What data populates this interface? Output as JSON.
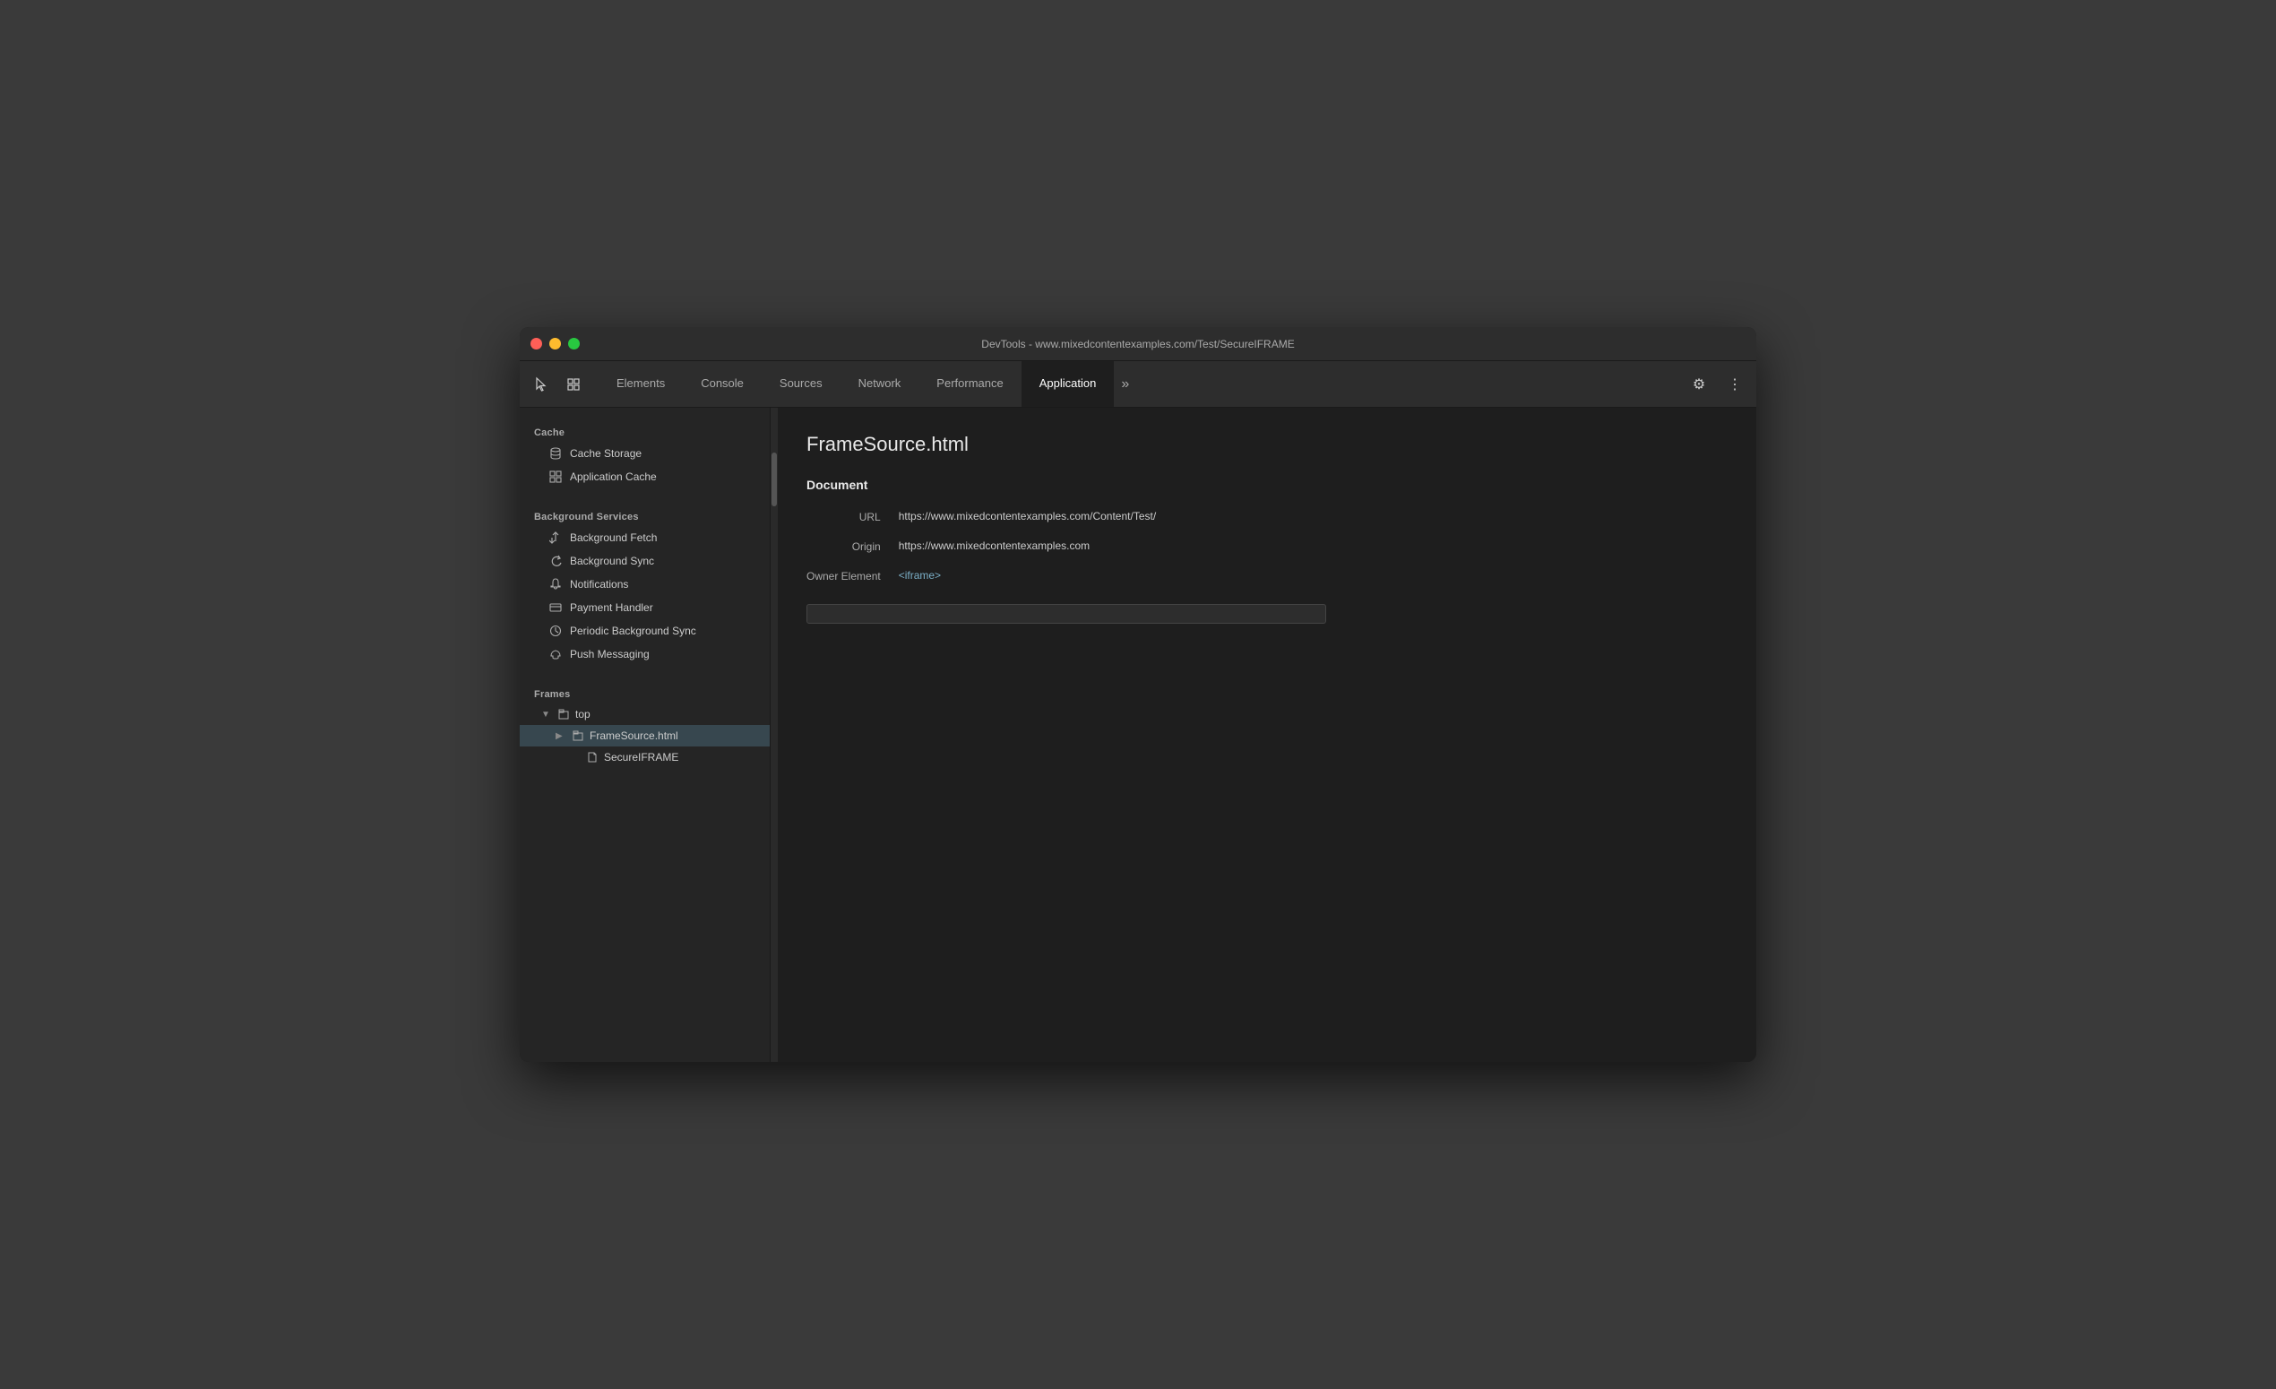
{
  "window": {
    "title": "DevTools - www.mixedcontentexamples.com/Test/SecureIFRAME"
  },
  "toolbar": {
    "tabs": [
      {
        "id": "elements",
        "label": "Elements",
        "active": false
      },
      {
        "id": "console",
        "label": "Console",
        "active": false
      },
      {
        "id": "sources",
        "label": "Sources",
        "active": false
      },
      {
        "id": "network",
        "label": "Network",
        "active": false
      },
      {
        "id": "performance",
        "label": "Performance",
        "active": false
      },
      {
        "id": "application",
        "label": "Application",
        "active": true
      }
    ],
    "more_label": "»",
    "settings_icon": "⚙",
    "menu_icon": "⋮"
  },
  "sidebar": {
    "sections": {
      "cache": {
        "label": "Cache",
        "items": [
          {
            "id": "cache-storage",
            "label": "Cache Storage",
            "icon": "db"
          },
          {
            "id": "application-cache",
            "label": "Application Cache",
            "icon": "grid"
          }
        ]
      },
      "background_services": {
        "label": "Background Services",
        "items": [
          {
            "id": "background-fetch",
            "label": "Background Fetch",
            "icon": "updown"
          },
          {
            "id": "background-sync",
            "label": "Background Sync",
            "icon": "sync"
          },
          {
            "id": "notifications",
            "label": "Notifications",
            "icon": "bell"
          },
          {
            "id": "payment-handler",
            "label": "Payment Handler",
            "icon": "card"
          },
          {
            "id": "periodic-background-sync",
            "label": "Periodic Background Sync",
            "icon": "clock"
          },
          {
            "id": "push-messaging",
            "label": "Push Messaging",
            "icon": "cloud"
          }
        ]
      },
      "frames": {
        "label": "Frames"
      }
    },
    "frames_tree": [
      {
        "id": "top",
        "label": "top",
        "level": 1,
        "arrow": "▼",
        "icon": "□",
        "selected": false
      },
      {
        "id": "framesource",
        "label": "FrameSource.html",
        "level": 2,
        "arrow": "▶",
        "icon": "□",
        "selected": true
      },
      {
        "id": "secureiframe",
        "label": "SecureIFRAME",
        "level": 3,
        "arrow": "",
        "icon": "doc",
        "selected": false
      }
    ]
  },
  "content": {
    "title": "FrameSource.html",
    "section_heading": "Document",
    "fields": [
      {
        "id": "url",
        "label": "URL",
        "value": "https://www.mixedcontentexamples.com/Content/Test/",
        "is_link": false
      },
      {
        "id": "origin",
        "label": "Origin",
        "value": "https://www.mixedcontentexamples.com",
        "is_link": false
      },
      {
        "id": "owner-element",
        "label": "Owner Element",
        "value": "<iframe>",
        "is_link": true
      }
    ]
  },
  "icons": {
    "cursor": "↖",
    "layers": "⧉",
    "db": "🗄",
    "grid": "▦",
    "updown": "⇅",
    "sync": "↻",
    "bell": "🔔",
    "card": "💳",
    "clock": "🕐",
    "cloud": "☁"
  }
}
